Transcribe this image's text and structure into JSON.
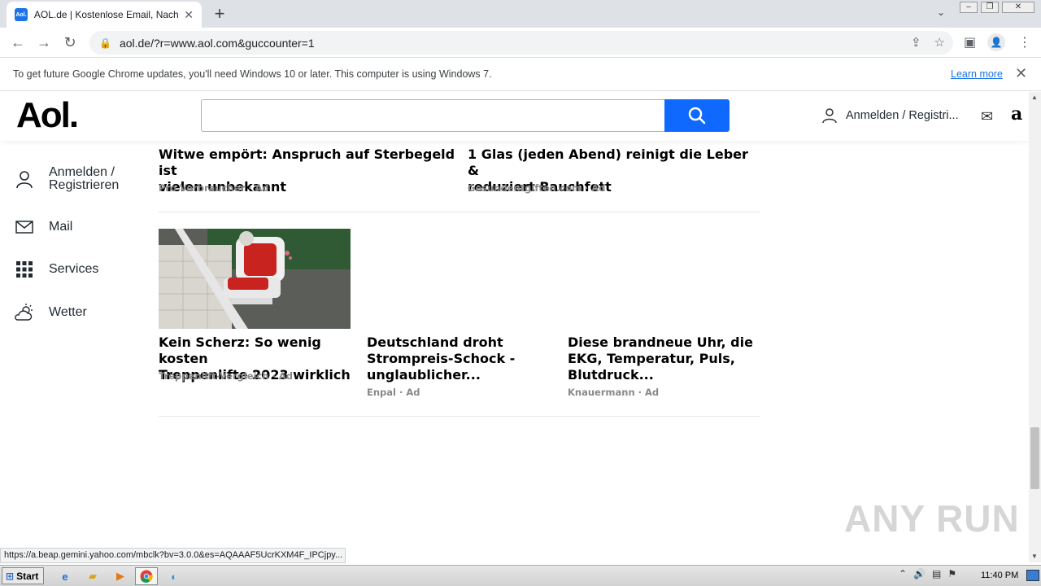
{
  "browser": {
    "tab_title": "AOL.de | Kostenlose Email, Nachrichten",
    "tab_favicon": "Aol.",
    "url": "aol.de/?r=www.aol.com&guccounter=1",
    "infobar_text": "To get future Google Chrome updates, you'll need Windows 10 or later. This computer is using Windows 7.",
    "infobar_link": "Learn more",
    "status_url": "https://a.beap.gemini.yahoo.com/mbclk?bv=3.0.0&es=AQAAAF5UcrKXM4F_IPCjpy..."
  },
  "header": {
    "logo": "Aol.",
    "signin": "Anmelden / Registri..."
  },
  "sidebar": {
    "items": [
      {
        "label_line1": "Anmelden /",
        "label_line2": "Registrieren",
        "icon": "user-icon"
      },
      {
        "label": "Mail",
        "icon": "mail-icon"
      },
      {
        "label": "Services",
        "icon": "grid-icon"
      },
      {
        "label": "Wetter",
        "icon": "weather-icon"
      }
    ]
  },
  "ads": [
    {
      "title_l1": "Witwe empört: Anspruch auf Sterbegeld ist",
      "title_l2": "vielen unbekannt",
      "source": "Pro Verbraucher · Ad"
    },
    {
      "title_l1": "1 Glas (jeden Abend) reinigt die Leber &",
      "title_l2": "reduziert Bauchfett",
      "source": "Gesundentgiften.com · Ad"
    },
    {
      "title_l1": "Kein Scherz: So wenig kosten",
      "title_l2": "Treppenlifte 2023 wirklich",
      "source": "Treppenlift-Vergleich · Ad"
    },
    {
      "title_l1": "Deutschland droht",
      "title_l2": "Strompreis-Schock -",
      "title_l3": "unglaublicher...",
      "source": "Enpal · Ad"
    },
    {
      "title_l1": "Diese brandneue Uhr, die",
      "title_l2": "EKG, Temperatur, Puls,",
      "title_l3": "Blutdruck...",
      "source": "Knauermann · Ad"
    }
  ],
  "watermark": "ANY RUN",
  "taskbar": {
    "start": "Start",
    "clock": "11:40 PM"
  }
}
